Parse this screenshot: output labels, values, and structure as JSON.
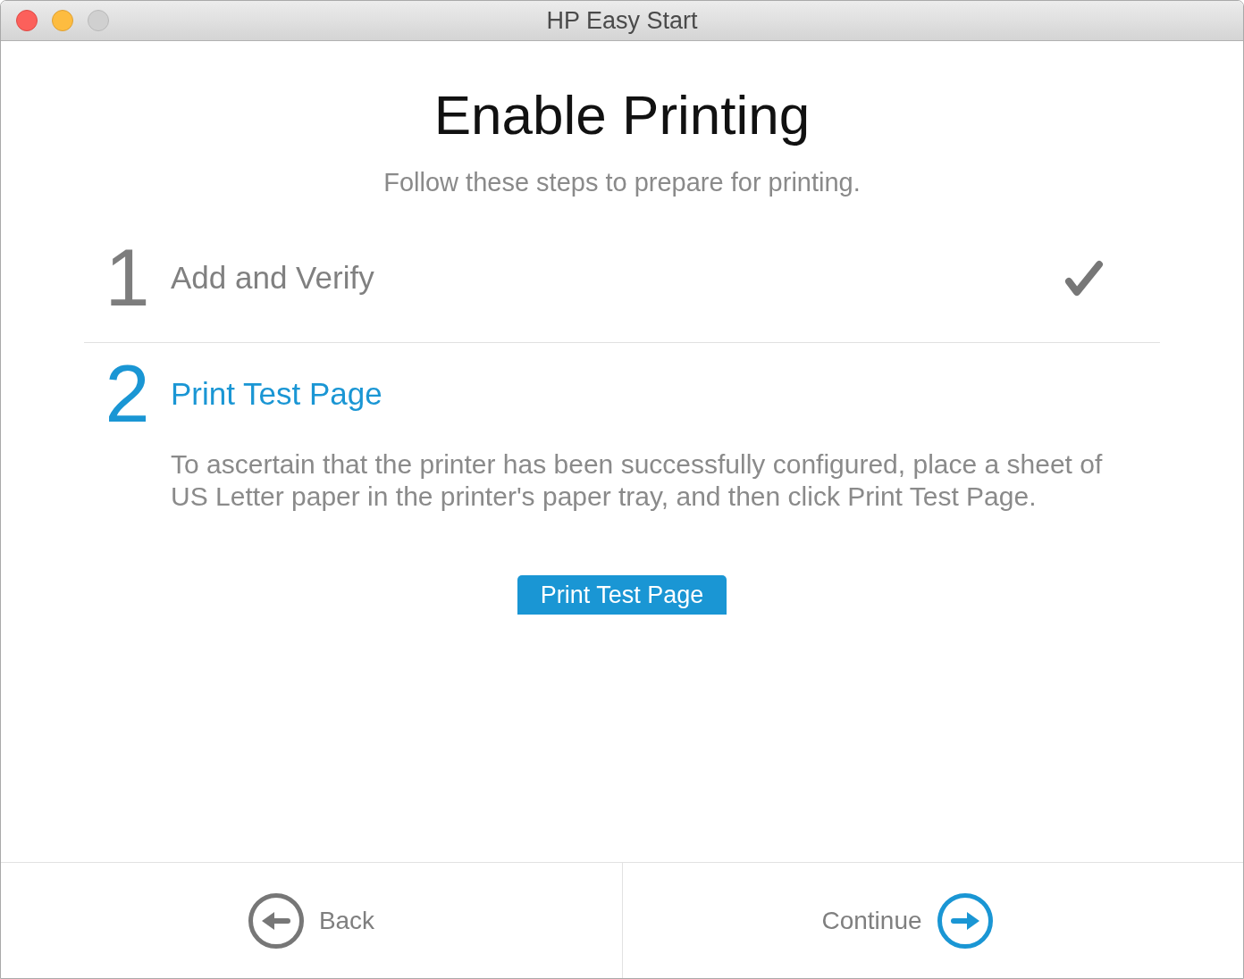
{
  "window": {
    "title": "HP Easy Start",
    "controls": [
      {
        "kind": "close",
        "disabled": false
      },
      {
        "kind": "minimize",
        "disabled": false
      },
      {
        "kind": "zoom",
        "disabled": true
      }
    ]
  },
  "heading": "Enable Printing",
  "subtitle": "Follow these steps to prepare for printing.",
  "steps": [
    {
      "number": "1",
      "title": "Add and Verify",
      "active": false,
      "completed": true
    },
    {
      "number": "2",
      "title": "Print Test Page",
      "active": true,
      "completed": false,
      "description": "To ascertain that the printer has been successfully configured, place a sheet of US Letter paper in the printer's paper tray, and then click Print Test Page.",
      "button": "Print Test Page"
    }
  ],
  "footer": {
    "buttons": [
      {
        "kind": "back",
        "label": "Back"
      },
      {
        "kind": "next",
        "label": "Continue"
      }
    ]
  }
}
